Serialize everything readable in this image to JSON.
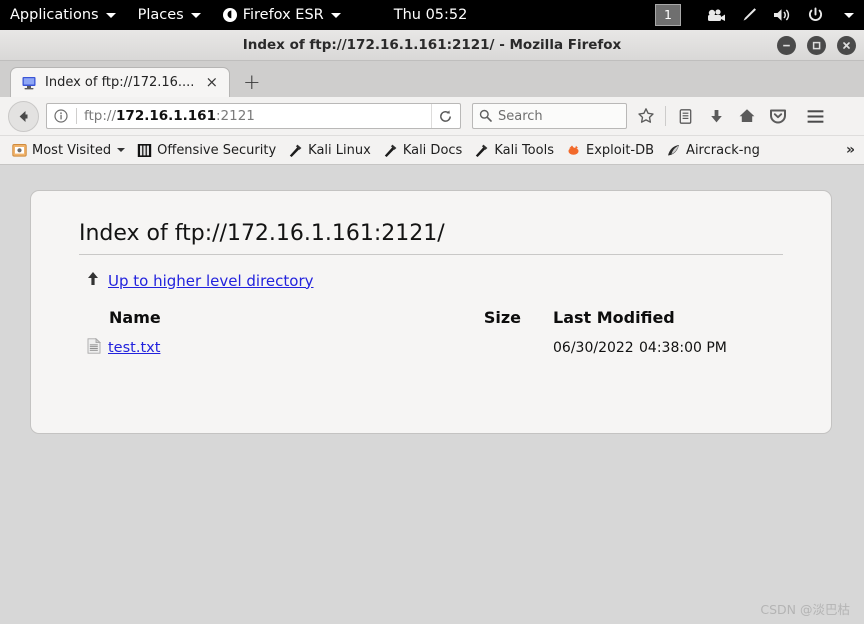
{
  "system_bar": {
    "menus": [
      {
        "label": "Applications",
        "icon": "none",
        "caret": true
      },
      {
        "label": "Places",
        "icon": "none",
        "caret": true
      },
      {
        "label": "Firefox ESR",
        "icon": "firefox-icon",
        "caret": true
      }
    ],
    "clock": "Thu 05:52",
    "workspace": "1",
    "tray_icons": [
      "video-camera-icon",
      "pen-icon",
      "volume-icon",
      "power-icon",
      "chevron-down-icon"
    ]
  },
  "window": {
    "title": "Index of ftp://172.16.1.161:2121/ - Mozilla Firefox",
    "controls": {
      "minimize": "minimize-icon",
      "maximize": "maximize-icon",
      "close": "close-icon"
    }
  },
  "tabs": {
    "items": [
      {
        "title": "Index of ftp://172.16....",
        "favicon": "computer-icon",
        "close": "×"
      }
    ],
    "new_tab": "+"
  },
  "toolbar": {
    "back_icon": "back-arrow-icon",
    "url": {
      "scheme": "ftp://",
      "host": "172.16.1.161",
      "port": ":2121",
      "info_icon": "info-icon",
      "reload_icon": "reload-icon"
    },
    "search": {
      "placeholder": "Search",
      "icon": "search-icon"
    },
    "icons": [
      "bookmark-star-icon",
      "library-icon",
      "downloads-icon",
      "home-icon",
      "pocket-icon",
      "menu-hamburger-icon"
    ]
  },
  "bookmarks": {
    "items": [
      {
        "label": "Most Visited",
        "icon": "most-visited-icon",
        "caret": true
      },
      {
        "label": "Offensive Security",
        "icon": "offensive-security-icon",
        "caret": false
      },
      {
        "label": "Kali Linux",
        "icon": "kali-icon",
        "caret": false
      },
      {
        "label": "Kali Docs",
        "icon": "kali-icon",
        "caret": false
      },
      {
        "label": "Kali Tools",
        "icon": "kali-icon",
        "caret": false
      },
      {
        "label": "Exploit-DB",
        "icon": "exploitdb-icon",
        "caret": false
      },
      {
        "label": "Aircrack-ng",
        "icon": "aircrack-icon",
        "caret": false
      }
    ],
    "overflow": "»"
  },
  "page": {
    "title": "Index of ftp://172.16.1.161:2121/",
    "up_link": "Up to higher level directory",
    "up_icon": "up-arrow-icon",
    "columns": {
      "name": "Name",
      "size": "Size",
      "modified": "Last Modified"
    },
    "rows": [
      {
        "icon": "file-icon",
        "name": "test.txt",
        "size": "",
        "date": "06/30/2022",
        "time": "04:38:00 PM"
      }
    ]
  },
  "watermark": "CSDN @淡巴枯",
  "colors": {
    "link": "#2222dd",
    "page_background": "#d7d7d7",
    "card_background": "#f6f5f4",
    "system_bar": "#000000"
  }
}
